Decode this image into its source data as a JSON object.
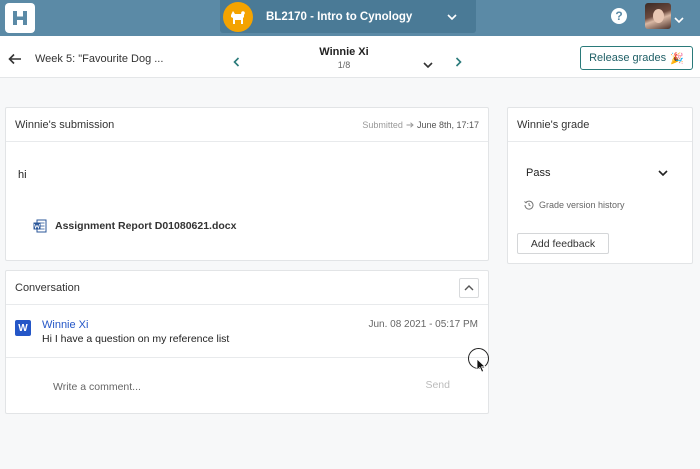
{
  "app": {
    "logo_icon": "h-logo-icon",
    "course": {
      "name": "BL2170 - Intro to Cynology",
      "avatar_icon": "dog-icon",
      "avatar_color": "#f4a300"
    },
    "help_icon": "question-icon",
    "user_avatar": "user-photo"
  },
  "subheader": {
    "assignment_title": "Week 5: \"Favourite Dog ...",
    "student_name": "Winnie Xi",
    "student_position": "1/8",
    "release_label": "Release grades",
    "release_emoji": "🎉"
  },
  "submission": {
    "title": "Winnie's submission",
    "submitted_label": "Submitted",
    "submitted_date": "June 8th, 17:17",
    "text": "hi",
    "attachment_name": "Assignment Report D01080621.docx",
    "attachment_icon": "word-doc-icon"
  },
  "conversation": {
    "title": "Conversation",
    "messages": [
      {
        "avatar_letter": "W",
        "author": "Winnie Xi",
        "time": "Jun. 08 2021 - 05:17 PM",
        "text": "Hi I have a question on my reference list"
      }
    ],
    "comment_placeholder": "Write a comment...",
    "send_label": "Send"
  },
  "grade": {
    "title": "Winnie's grade",
    "value": "Pass",
    "history_label": "Grade version history",
    "feedback_label": "Add feedback"
  },
  "colors": {
    "topbar": "#5b8aa6",
    "accent_teal": "#2a7a7a",
    "message_blue": "#2456c7"
  }
}
